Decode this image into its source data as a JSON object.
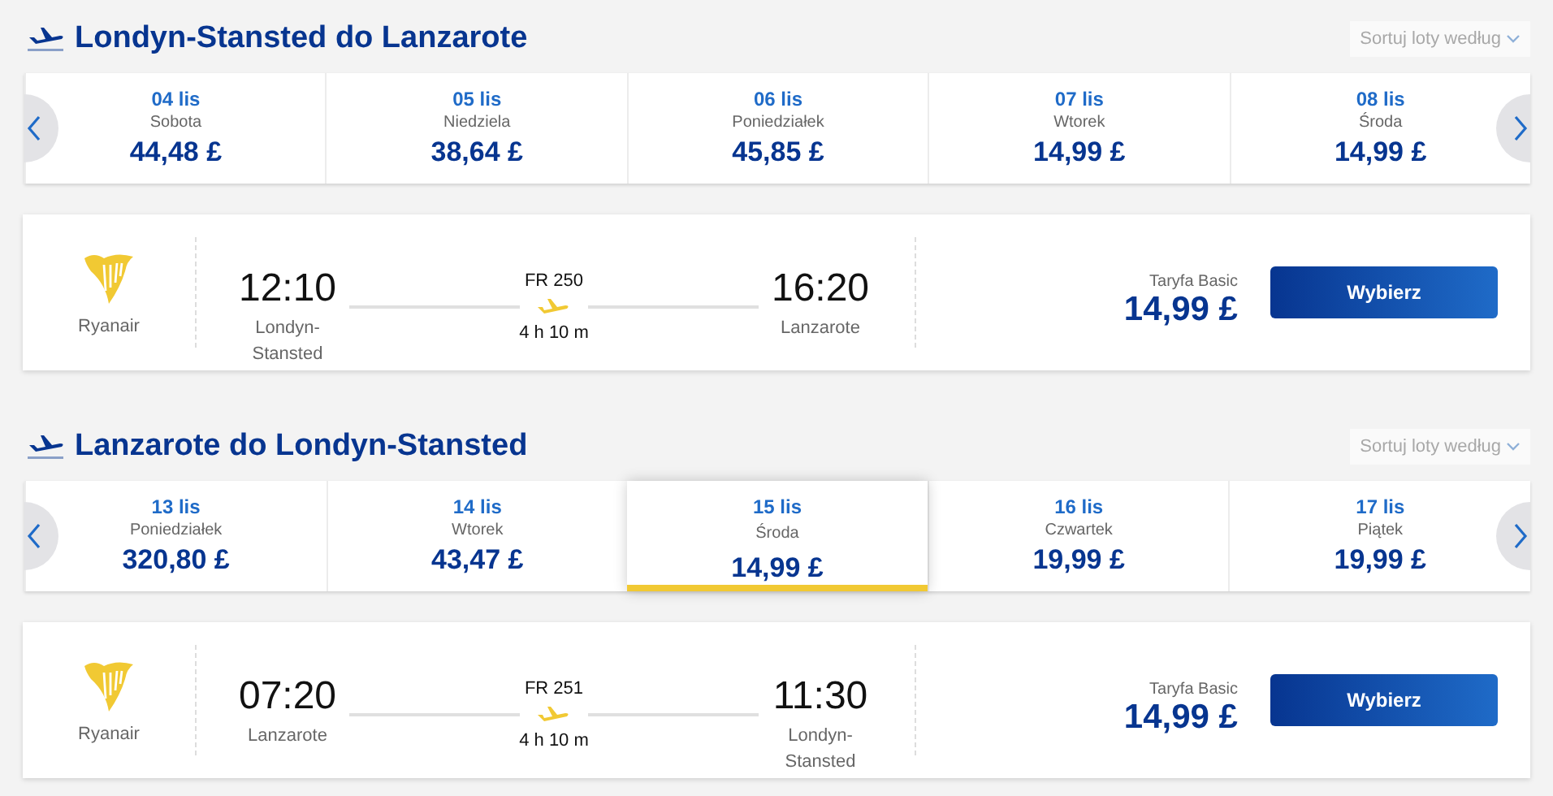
{
  "sections": [
    {
      "title": "Londyn-Stansted do Lanzarote",
      "sort_label": "Sortuj loty według",
      "dates": [
        {
          "date": "04 lis",
          "day": "Sobota",
          "price": "44,48 £",
          "selected": false
        },
        {
          "date": "05 lis",
          "day": "Niedziela",
          "price": "38,64 £",
          "selected": false
        },
        {
          "date": "06 lis",
          "day": "Poniedziałek",
          "price": "45,85 £",
          "selected": false
        },
        {
          "date": "07 lis",
          "day": "Wtorek",
          "price": "14,99 £",
          "selected": false
        },
        {
          "date": "08 lis",
          "day": "Środa",
          "price": "14,99 £",
          "selected": false
        }
      ],
      "flight": {
        "airline": "Ryanair",
        "depart_time": "12:10",
        "depart_city": "Londyn-Stansted",
        "flight_number": "FR 250",
        "duration": "4 h 10 m",
        "arrive_time": "16:20",
        "arrive_city": "Lanzarote",
        "fare_label": "Taryfa Basic",
        "price": "14,99 £",
        "button": "Wybierz"
      }
    },
    {
      "title": "Lanzarote do Londyn-Stansted",
      "sort_label": "Sortuj loty według",
      "dates": [
        {
          "date": "13 lis",
          "day": "Poniedziałek",
          "price": "320,80 £",
          "selected": false
        },
        {
          "date": "14 lis",
          "day": "Wtorek",
          "price": "43,47 £",
          "selected": false
        },
        {
          "date": "15 lis",
          "day": "Środa",
          "price": "14,99 £",
          "selected": true
        },
        {
          "date": "16 lis",
          "day": "Czwartek",
          "price": "19,99 £",
          "selected": false
        },
        {
          "date": "17 lis",
          "day": "Piątek",
          "price": "19,99 £",
          "selected": false
        }
      ],
      "flight": {
        "airline": "Ryanair",
        "depart_time": "07:20",
        "depart_city": "Lanzarote",
        "flight_number": "FR 251",
        "duration": "4 h 10 m",
        "arrive_time": "11:30",
        "arrive_city": "Londyn-Stansted",
        "fare_label": "Taryfa Basic",
        "price": "14,99 £",
        "button": "Wybierz"
      }
    }
  ]
}
